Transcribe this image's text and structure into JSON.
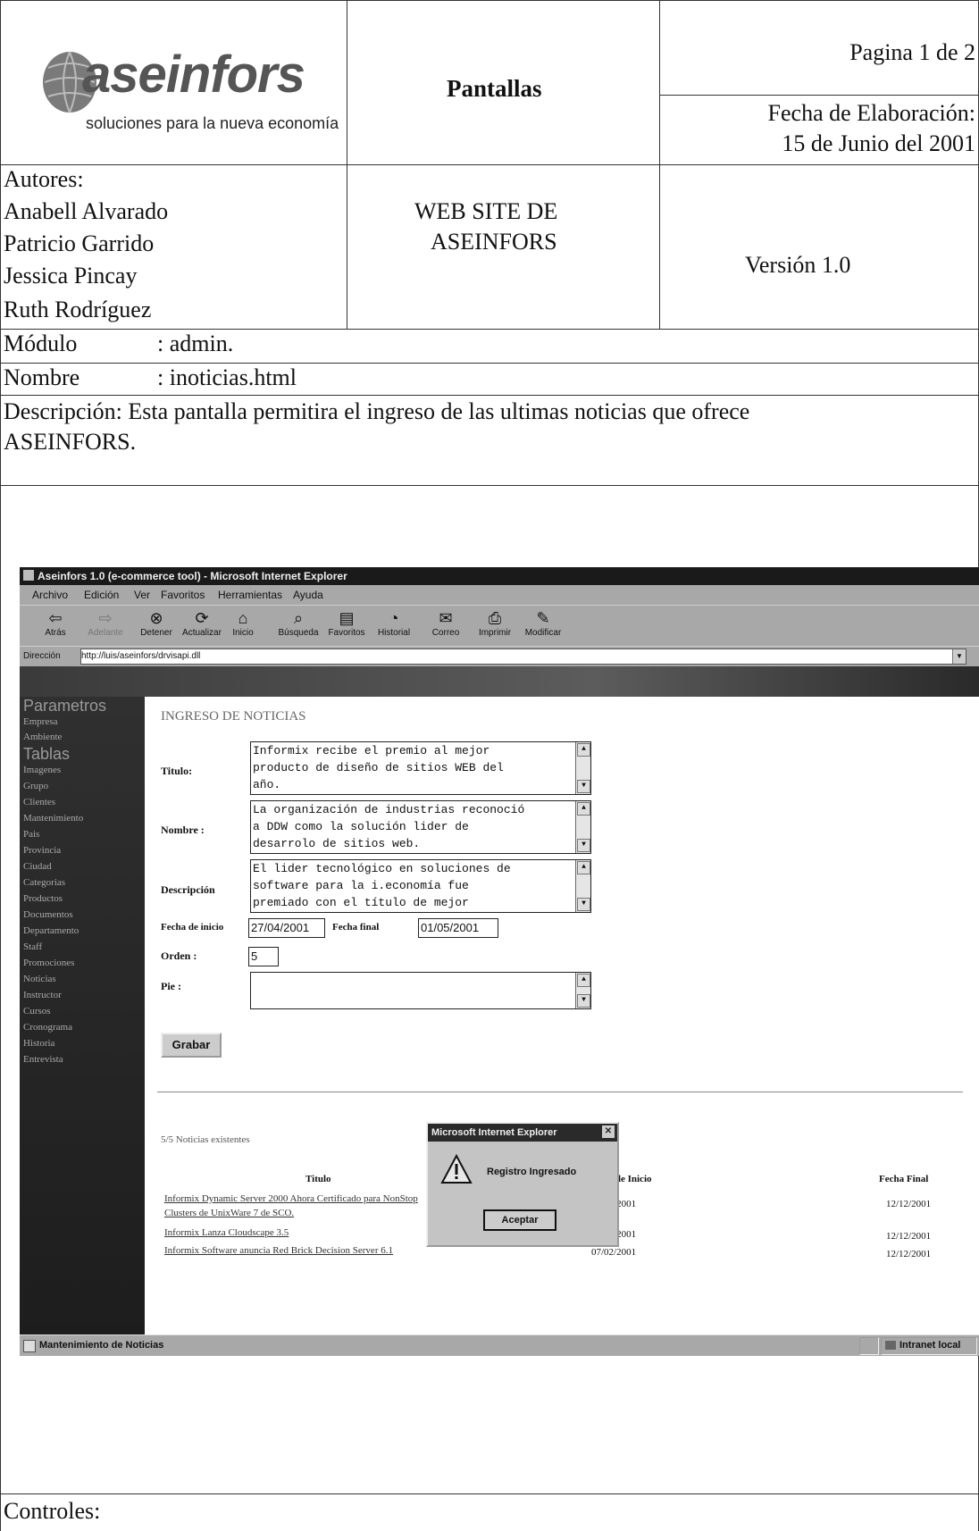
{
  "header": {
    "logo_word": "aseinfors",
    "logo_tagline": "soluciones para la nueva economía",
    "section_title": "Pantallas",
    "page_info": "Pagina 1 de 2",
    "date_label": "Fecha de Elaboración:",
    "date_value": "15 de Junio del 2001",
    "authors_label": "Autores:",
    "authors": [
      "Anabell Alvarado",
      "Patricio Garrido",
      "Jessica Pincay",
      "Ruth Rodríguez"
    ],
    "project_line1": "WEB SITE DE",
    "project_line2": "ASEINFORS",
    "version": "Versión 1.0"
  },
  "fields": {
    "module_label": "Módulo",
    "module_value": ": admin.",
    "name_label": "Nombre",
    "name_value": ": inoticias.html",
    "desc_line1": "Descripción: Esta pantalla permitira el ingreso de las ultimas noticias que ofrece",
    "desc_line2": "ASEINFORS."
  },
  "browser": {
    "window_title": "Aseinfors 1.0 (e-commerce tool) - Microsoft Internet Explorer",
    "menu": [
      "Archivo",
      "Edición",
      "Ver",
      "Favoritos",
      "Herramientas",
      "Ayuda"
    ],
    "toolbar": [
      "Atrás",
      "Adelante",
      "Detener",
      "Actualizar",
      "Inicio",
      "Búsqueda",
      "Favoritos",
      "Historial",
      "Correo",
      "Imprimir",
      "Modificar"
    ],
    "address_label": "Dirección",
    "address_value": "http://luis/aseinfors/drvisapi.dll",
    "status_left": "Mantenimiento de Noticias",
    "status_right": "Intranet local"
  },
  "sidebar": {
    "heading1": "Parametros",
    "group1": [
      "Empresa",
      "Ambiente"
    ],
    "heading2": "Tablas",
    "group2": [
      "Imagenes",
      "Grupo",
      "Clientes",
      "Mantenimiento",
      "Pais",
      "Provincia",
      "Ciudad",
      "Categorias",
      "Productos",
      "Documentos",
      "Departamento",
      "Staff",
      "Promociones",
      "Noticias",
      "Instructor",
      "Cursos",
      "Cronograma",
      "Historia",
      "Entrevista"
    ]
  },
  "form": {
    "heading": "INGRESO DE NOTICIAS",
    "titulo_label": "Titulo:",
    "titulo_value": "Informix recibe el premio al mejor\nproducto de diseño de sitios WEB del\naño.",
    "nombre_label": "Nombre :",
    "nombre_value": "La organización de industrias reconoció\na DDW como la solución lider de\ndesarrolo de sitios web.",
    "descripcion_label": "Descripción",
    "descripcion_value": "El lider tecnológico en soluciones de\nsoftware para la i.economía fue\npremiado con el título de mejor",
    "fecha_inicio_label": "Fecha de inicio",
    "fecha_inicio_value": "27/04/2001",
    "fecha_final_label": "Fecha final",
    "fecha_final_value": "01/05/2001",
    "orden_label": "Orden :",
    "orden_value": "5",
    "pie_label": "Pie :",
    "pie_value": "",
    "save_button": "Grabar",
    "count_text": "5/5 Noticias existentes"
  },
  "table": {
    "headers": [
      "Titulo",
      "Fecha de Inicio",
      "Fecha Final"
    ],
    "rows": [
      {
        "title1": "Informix Dynamic Server 2000 Ahora Certificado para NonStop",
        "title2": "Clusters de UnixWare 7 de SCO.",
        "start": "07/02/2001",
        "end": "12/12/2001"
      },
      {
        "title1": "Informix Lanza Cloudscape 3.5",
        "title2": "",
        "start": "07/02/2001",
        "end": "12/12/2001"
      },
      {
        "title1": "Informix Software anuncia Red Brick Decision Server 6.1",
        "title2": "",
        "start": "07/02/2001",
        "end": "12/12/2001"
      }
    ]
  },
  "dialog": {
    "title": "Microsoft Internet Explorer",
    "message": "Registro Ingresado",
    "button": "Aceptar"
  },
  "footer": {
    "controls_label": "Controles:"
  }
}
